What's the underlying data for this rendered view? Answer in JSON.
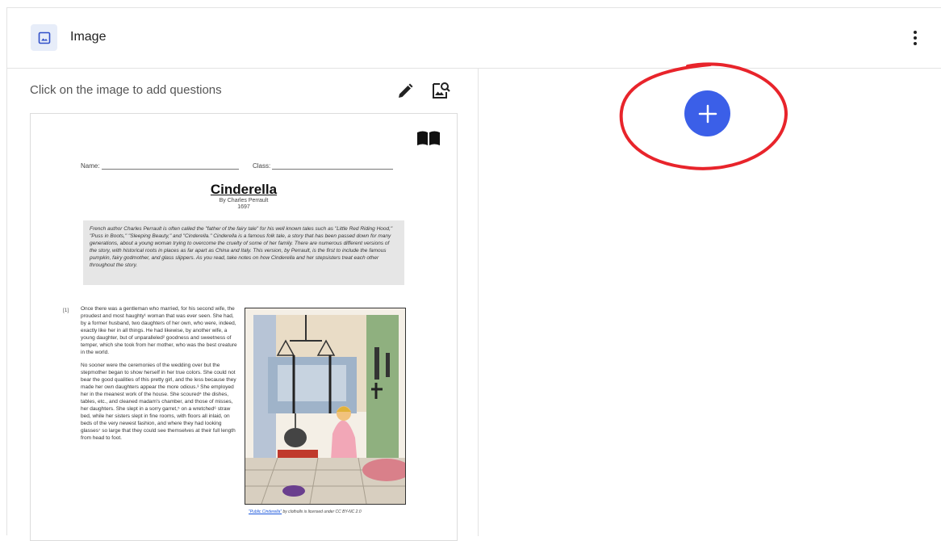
{
  "header": {
    "title": "Image",
    "icon": "image-icon",
    "menu_icon": "more-vertical-icon"
  },
  "editor": {
    "hint": "Click on the image to add questions",
    "tools": [
      "pencil-icon",
      "image-search-icon"
    ]
  },
  "document": {
    "name_label": "Name:",
    "class_label": "Class:",
    "title": "Cinderella",
    "author": "By Charles Perrault",
    "year": "1697",
    "intro": "French author Charles Perrault is often called the \"father of the fairy tale\" for his well known tales such as \"Little Red Riding Hood,\" \"Puss in Boots,\" \"Sleeping Beauty,\" and \"Cinderella.\" Cinderella is a famous folk tale, a story that has been passed down for many generations, about a young woman trying to overcome the cruelty of some of her family. There are numerous different versions of the story, with historical roots in places as far apart as China and Italy. This version, by Perrault, is the first to include the famous pumpkin, fairy godmother, and glass slippers. As you read, take notes on how Cinderella and her stepsisters treat each other throughout the story.",
    "para_number": "[1]",
    "paragraphs": [
      "Once there was a gentleman who married, for his second wife, the proudest and most haughty¹ woman that was ever seen. She had, by a former husband, two daughters of her own, who were, indeed, exactly like her in all things. He had likewise, by another wife, a young daughter, but of unparalleled² goodness and sweetness of temper, which she took from her mother, who was the best creature in the world.",
      "No sooner were the ceremonies of the wedding over but the stepmother began to show herself in her true colors. She could not bear the good qualities of this pretty girl, and the less because they made her own daughters appear the more odious.³ She employed her in the meanest work of the house. She scoured⁴ the dishes, tables, etc., and cleaned madam's chamber, and those of misses, her daughters. She slept in a sorry garret,⁵ on a wretched⁶ straw bed, while her sisters slept in fine rooms, with floors all inlaid, on beds of the very newest fashion, and where they had looking glasses⁷ so large that they could see themselves at their full length from head to foot."
    ],
    "caption_link": "\"Public Cinderella\"",
    "caption_rest": " by clothollx is licensed under CC BY-NC 2.0"
  },
  "actions": {
    "add_icon": "plus-icon"
  },
  "colors": {
    "accent": "#3b5fe8",
    "annotation": "#e8242b",
    "icon_bg": "#e7edf9"
  }
}
